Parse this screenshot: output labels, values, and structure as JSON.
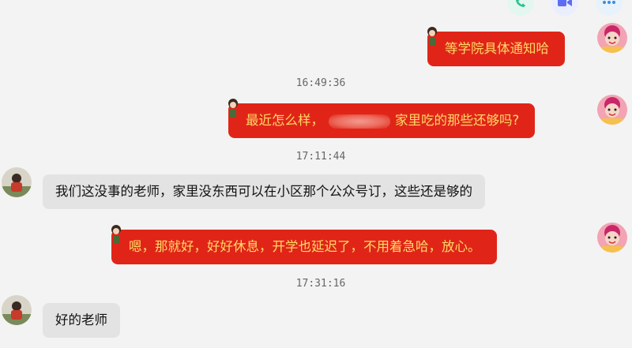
{
  "toolbar": {
    "call_icon": "phone-icon",
    "video_icon": "video-camera-icon",
    "more_icon": "more-dots-icon",
    "colors": {
      "call": "#2fbf8f",
      "video": "#5b6ef5",
      "more": "#3a8de0"
    }
  },
  "colors": {
    "outgoing_bubble": "#e02518",
    "outgoing_text": "#ffd966",
    "incoming_bubble": "#e3e3e3"
  },
  "messages": [
    {
      "direction": "out",
      "text": "等学院具体通知哈"
    },
    {
      "type": "timestamp",
      "text": "16:49:36"
    },
    {
      "direction": "out",
      "text_before": "最近怎么样，",
      "text_after": "家里吃的那些还够吗?"
    },
    {
      "type": "timestamp",
      "text": "17:11:44"
    },
    {
      "direction": "in",
      "text": "我们这没事的老师，家里没东西可以在小区那个公众号订，这些还是够的"
    },
    {
      "direction": "out",
      "text": "嗯，那就好，好好休息，开学也延迟了，不用着急哈，放心。"
    },
    {
      "type": "timestamp",
      "text": "17:31:16"
    },
    {
      "direction": "in",
      "text": "好的老师"
    }
  ]
}
